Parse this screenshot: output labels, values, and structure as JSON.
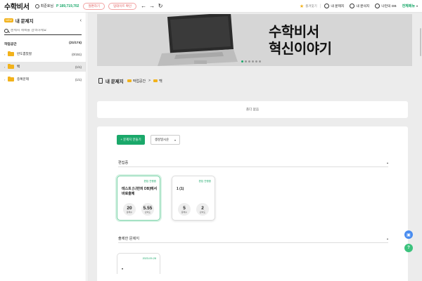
{
  "header": {
    "logo": "수학비서",
    "user_name": "최준호님",
    "points": "P 189,719,702",
    "pill_1": "절편하기",
    "pill_2": "업데이트 확인",
    "favorites": "즐겨찾기",
    "nav_my_problems": "내 문제지",
    "nav_analysis": "내 분석지",
    "nav_my_db": "나만의 DB",
    "service": "전체메뉴"
  },
  "sidebar": {
    "badge": "NEW",
    "title": "내 문제지",
    "search_placeholder": "문제지 제목을 검색하세요",
    "workspace_label": "작업공간",
    "workspace_count": "(21/174)",
    "items": [
      {
        "label": "반도뽑았할",
        "count": "(0/151)"
      },
      {
        "label": "백",
        "count": "(1/1)"
      },
      {
        "label": "중복문제",
        "count": "(1/1)"
      }
    ]
  },
  "banner": {
    "line1": "수학비서",
    "line2": "혁신이야기"
  },
  "breadcrumb": {
    "title": "내 문제지",
    "folder_1": "작업공간",
    "separator": ">",
    "folder_2": "백"
  },
  "empty_message": "폴더 없음",
  "toolbar": {
    "create_label": "+ 문제지 만들기",
    "sort_value": "생성일시순"
  },
  "sections": {
    "editing": "편집중",
    "published": "출제한 문제지"
  },
  "cards": [
    {
      "tag": "편집 진행중",
      "title": "테스트 [나만의 DB]에서 바로출제",
      "problems": "20",
      "problems_label": "문제수",
      "difficulty": "5.55",
      "difficulty_label": "난이도"
    },
    {
      "tag": "편집 진행중",
      "title": "1 (1)",
      "problems": "5",
      "problems_label": "문제수",
      "difficulty": "2",
      "difficulty_label": "난이도"
    }
  ],
  "published_card": {
    "date": "2023-09-28"
  },
  "colors": {
    "accent": "#1aa86a",
    "folder": "#f2b21b",
    "pill": "#e05a5a",
    "float_blue": "#4a8df0",
    "float_green": "#3cc27d"
  }
}
